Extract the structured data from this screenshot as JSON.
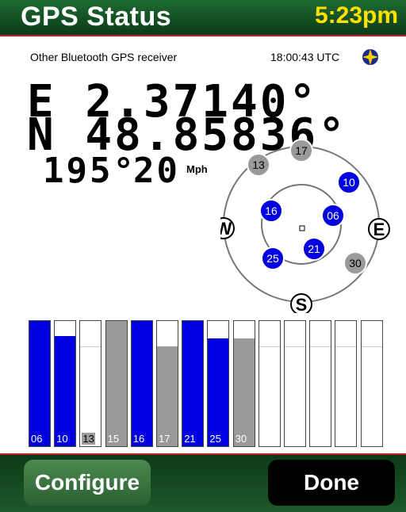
{
  "header": {
    "title": "GPS Status",
    "time": "5:23pm"
  },
  "status": {
    "receiver": "Other Bluetooth GPS receiver",
    "utc": "18:00:43 UTC",
    "fix_icon": "gps-fix-icon"
  },
  "position": {
    "longitude": "E  2.37140°",
    "latitude": "N 48.85836°"
  },
  "motion": {
    "heading": "195°",
    "speed": "20",
    "speed_unit": "Mph"
  },
  "compass": {
    "west": "W",
    "east": "E",
    "south": "S"
  },
  "skyplot": [
    {
      "id": "17",
      "state": "gray"
    },
    {
      "id": "13",
      "state": "gray"
    },
    {
      "id": "10",
      "state": "blue"
    },
    {
      "id": "16",
      "state": "blue"
    },
    {
      "id": "06",
      "state": "blue"
    },
    {
      "id": "21",
      "state": "blue"
    },
    {
      "id": "25",
      "state": "blue"
    },
    {
      "id": "30",
      "state": "gray"
    }
  ],
  "signal_bars": [
    {
      "id": "06",
      "level": 1.0,
      "state": "blue"
    },
    {
      "id": "10",
      "level": 0.88,
      "state": "blue"
    },
    {
      "id": "13",
      "level": 0.0,
      "state": "gray"
    },
    {
      "id": "15",
      "level": 1.0,
      "state": "gray"
    },
    {
      "id": "16",
      "level": 1.0,
      "state": "blue"
    },
    {
      "id": "17",
      "level": 0.8,
      "state": "gray"
    },
    {
      "id": "21",
      "level": 1.0,
      "state": "blue"
    },
    {
      "id": "25",
      "level": 0.86,
      "state": "blue"
    },
    {
      "id": "30",
      "level": 0.86,
      "state": "gray"
    },
    {
      "id": "",
      "level": 0.0,
      "state": "empty"
    },
    {
      "id": "",
      "level": 0.0,
      "state": "empty"
    },
    {
      "id": "",
      "level": 0.0,
      "state": "empty"
    },
    {
      "id": "",
      "level": 0.0,
      "state": "empty"
    },
    {
      "id": "",
      "level": 0.0,
      "state": "empty"
    }
  ],
  "colors": {
    "blue": "#0000e0",
    "gray": "#9a9a9a",
    "green": "#1e6b32",
    "accent": "#ffe000"
  },
  "buttons": {
    "configure": "Configure",
    "done": "Done"
  }
}
